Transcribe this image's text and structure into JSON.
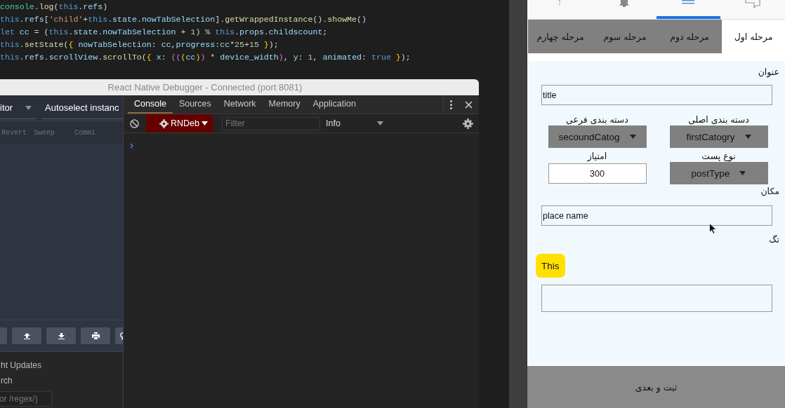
{
  "editor": {
    "code_lines": [
      {
        "segments": [
          {
            "text": "console",
            "kind": "cls"
          },
          {
            "text": ".",
            "kind": "p"
          },
          {
            "text": "log",
            "kind": "fn"
          },
          {
            "text": "(",
            "kind": "p"
          },
          {
            "text": "this",
            "kind": "kw"
          },
          {
            "text": ".",
            "kind": "p"
          },
          {
            "text": "refs",
            "kind": "var"
          },
          {
            "text": ")",
            "kind": "p"
          }
        ]
      },
      {
        "segments": [
          {
            "text": "this",
            "kind": "kw"
          },
          {
            "text": ".",
            "kind": "p"
          },
          {
            "text": "refs",
            "kind": "var"
          },
          {
            "text": "[",
            "kind": "p"
          },
          {
            "text": "'child'",
            "kind": "str"
          },
          {
            "text": "+",
            "kind": "p"
          },
          {
            "text": "this",
            "kind": "kw"
          },
          {
            "text": ".",
            "kind": "p"
          },
          {
            "text": "state",
            "kind": "var"
          },
          {
            "text": ".",
            "kind": "p"
          },
          {
            "text": "nowTabSelection",
            "kind": "var"
          },
          {
            "text": "].",
            "kind": "p"
          },
          {
            "text": "getWrappedInstance",
            "kind": "fn"
          },
          {
            "text": "().",
            "kind": "p"
          },
          {
            "text": "showMe",
            "kind": "fn"
          },
          {
            "text": "()",
            "kind": "p"
          }
        ]
      },
      {
        "segments": [
          {
            "text": "let",
            "kind": "kw"
          },
          {
            "text": " cc",
            "kind": "var"
          },
          {
            "text": " = (",
            "kind": "p"
          },
          {
            "text": "this",
            "kind": "kw"
          },
          {
            "text": ".",
            "kind": "p"
          },
          {
            "text": "state",
            "kind": "var"
          },
          {
            "text": ".",
            "kind": "p"
          },
          {
            "text": "nowTabSelection",
            "kind": "var"
          },
          {
            "text": " + ",
            "kind": "p"
          },
          {
            "text": "1",
            "kind": "num"
          },
          {
            "text": ") % ",
            "kind": "p"
          },
          {
            "text": "this",
            "kind": "kw"
          },
          {
            "text": ".",
            "kind": "p"
          },
          {
            "text": "props",
            "kind": "var"
          },
          {
            "text": ".",
            "kind": "p"
          },
          {
            "text": "childscount",
            "kind": "var"
          },
          {
            "text": ";",
            "kind": "p"
          }
        ]
      },
      {
        "segments": [
          {
            "text": "this",
            "kind": "kw"
          },
          {
            "text": ".",
            "kind": "p"
          },
          {
            "text": "setState",
            "kind": "fn"
          },
          {
            "text": "(",
            "kind": "p"
          },
          {
            "text": "{",
            "kind": "br"
          },
          {
            "text": " nowTabSelection",
            "kind": "var"
          },
          {
            "text": ": ",
            "kind": "p"
          },
          {
            "text": "cc",
            "kind": "var"
          },
          {
            "text": ",",
            "kind": "p"
          },
          {
            "text": "progress",
            "kind": "var"
          },
          {
            "text": ":",
            "kind": "p"
          },
          {
            "text": "cc",
            "kind": "var"
          },
          {
            "text": "*",
            "kind": "p"
          },
          {
            "text": "25",
            "kind": "num"
          },
          {
            "text": "+",
            "kind": "p"
          },
          {
            "text": "15",
            "kind": "num"
          },
          {
            "text": " }",
            "kind": "br"
          },
          {
            "text": ");",
            "kind": "p"
          }
        ]
      },
      {
        "segments": [
          {
            "text": "this",
            "kind": "kw"
          },
          {
            "text": ".",
            "kind": "p"
          },
          {
            "text": "refs",
            "kind": "var"
          },
          {
            "text": ".",
            "kind": "p"
          },
          {
            "text": "scrollView",
            "kind": "var"
          },
          {
            "text": ".",
            "kind": "p"
          },
          {
            "text": "scrollTo",
            "kind": "fn"
          },
          {
            "text": "(",
            "kind": "p"
          },
          {
            "text": "{",
            "kind": "br"
          },
          {
            "text": " x",
            "kind": "var"
          },
          {
            "text": ": ",
            "kind": "p"
          },
          {
            "text": "((",
            "kind": "pk"
          },
          {
            "text": "(",
            "kind": "br"
          },
          {
            "text": "cc",
            "kind": "var"
          },
          {
            "text": ")",
            "kind": "br"
          },
          {
            "text": ")",
            "kind": "pk"
          },
          {
            "text": " * ",
            "kind": "p"
          },
          {
            "text": "device_width",
            "kind": "var"
          },
          {
            "text": ")",
            "kind": "pk"
          },
          {
            "text": ", ",
            "kind": "p"
          },
          {
            "text": "y",
            "kind": "var"
          },
          {
            "text": ": ",
            "kind": "p"
          },
          {
            "text": "1",
            "kind": "num"
          },
          {
            "text": ", ",
            "kind": "p"
          },
          {
            "text": "animated",
            "kind": "var"
          },
          {
            "text": ": ",
            "kind": "p"
          },
          {
            "text": "true",
            "kind": "kw"
          },
          {
            "text": " }",
            "kind": "br"
          },
          {
            "text": ");",
            "kind": "p"
          }
        ]
      }
    ]
  },
  "debugger": {
    "title": "React Native Debugger - Connected (port 8081)",
    "redux_panel": {
      "monitor_select": "itor",
      "instance_select": "Autoselect instanc",
      "actions": [
        "Revert",
        "Sweep",
        "Commi"
      ],
      "toolbar_buttons": [
        {
          "kind": "partial"
        },
        {
          "kind": "upload"
        },
        {
          "kind": "download"
        },
        {
          "kind": "print"
        },
        {
          "kind": "bulb"
        }
      ],
      "settings_labels": [
        "ht Updates",
        "rch"
      ],
      "search": {
        "placeholder": "or /regex/)"
      }
    },
    "devtools": {
      "tabs": [
        {
          "label": "Console",
          "selected": true
        },
        {
          "label": "Sources",
          "selected": false
        },
        {
          "label": "Network",
          "selected": false
        },
        {
          "label": "Memory",
          "selected": false
        },
        {
          "label": "Application",
          "selected": false
        }
      ],
      "context": "RNDeb",
      "filter": {
        "placeholder": "Filter"
      },
      "level": "Info"
    }
  },
  "phone": {
    "nav_tabs": [
      {
        "kind": "help",
        "selected": false
      },
      {
        "kind": "bell",
        "selected": false
      },
      {
        "kind": "menu",
        "selected": true
      },
      {
        "kind": "chat",
        "selected": false
      }
    ],
    "stage_tabs": [
      {
        "label": "مرحله اول",
        "selected": true
      },
      {
        "label": "مرحله دوم",
        "selected": false
      },
      {
        "label": "مرحله سوم",
        "selected": false
      },
      {
        "label": "مرحله چهارم",
        "selected": false
      }
    ],
    "form": {
      "title_label": "عنوان",
      "title_field": {
        "value": "title"
      },
      "grid_rows": [
        {
          "right": {
            "kind": "select",
            "label": "دسته بندی اصلی",
            "value": "firstCatogry"
          },
          "left": {
            "kind": "select",
            "label": "دسته بندی فرعی",
            "value": "secoundCatog"
          }
        },
        {
          "right": {
            "kind": "select",
            "label": "نوع پست",
            "value": "postType"
          },
          "left": {
            "kind": "input",
            "label": "امتیاز",
            "value": "300"
          }
        }
      ],
      "place_label": "مکان",
      "place_field": {
        "value": "place name"
      },
      "tag_label": "تگ",
      "tags": [
        "This"
      ]
    },
    "submit_button": "ثبت و بعدی"
  }
}
